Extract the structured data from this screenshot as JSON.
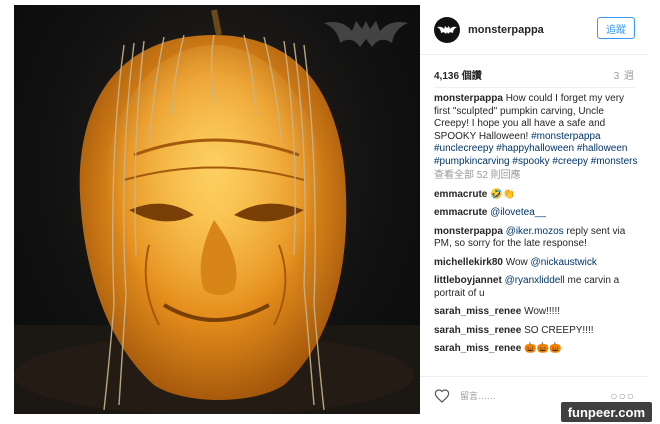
{
  "post": {
    "username": "monsterpappa",
    "follow_label": "追蹤",
    "views": "4,136 個讚",
    "age": "3 週",
    "caption_user": "monsterpappa",
    "caption_text": "How could I forget my very first \"sculpted\" pumpkin carving, Uncle Creepy! I hope you all have a safe and SPOOKY Halloween!",
    "hashtags": [
      "#monsterpappa",
      "#unclecreepy",
      "#happyhalloween",
      "#halloween",
      "#pumpkincarving",
      "#spooky",
      "#creepy",
      "#monsters"
    ],
    "load_more": "查看全部 52 則回應"
  },
  "comments": [
    {
      "user": "emmacrute",
      "text": "🤣👏"
    },
    {
      "user": "emmacrute",
      "mention": "@ilovetea__",
      "text": ""
    },
    {
      "user": "monsterpappa",
      "mention": "@iker.mozos",
      "text": " reply sent via PM, so sorry for the late response!"
    },
    {
      "user": "michellekirk80",
      "text": "Wow ",
      "mention": "@nickaustwick"
    },
    {
      "user": "littleboyjannet",
      "mention": "@ryanxliddell",
      "text": " me carvin a portrait of u"
    },
    {
      "user": "sarah_miss_renee",
      "text": "Wow!!!!!"
    },
    {
      "user": "sarah_miss_renee",
      "text": "SO CREEPY!!!!"
    },
    {
      "user": "sarah_miss_renee",
      "text": "🎃🎃🎃"
    }
  ],
  "actions": {
    "comment_placeholder": "留言……",
    "more": "○○○"
  },
  "watermark": "funpeer.com",
  "colors": {
    "link": "#003569",
    "follow": "#3897f0"
  }
}
